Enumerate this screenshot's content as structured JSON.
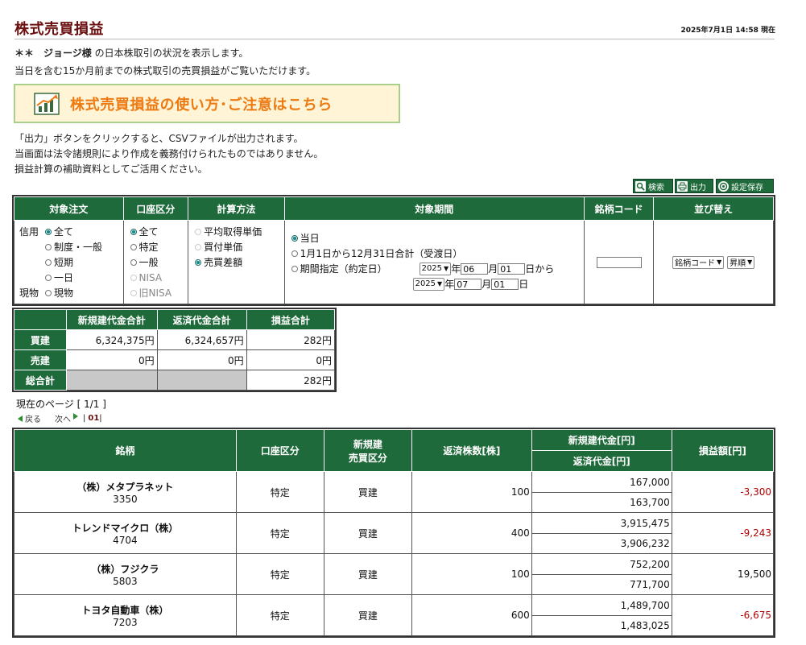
{
  "header": {
    "title": "株式売買損益",
    "timestamp": "2025年7月1日 14:58 現在"
  },
  "intro": {
    "user_prefix": "＊＊　ジョージ様",
    "user_suffix": "の日本株取引の状況を表示します。",
    "line2": "当日を含む15か月前までの株式取引の売買損益がご覧いただけます。"
  },
  "banner": {
    "text": "株式売買損益の使い方･ご注意はこちら",
    "icon": "chart-icon"
  },
  "notes": [
    "「出力」ボタンをクリックすると、CSVファイルが出力されます。",
    "当画面は法令諸規則により作成を義務付けられたものではありません。",
    "損益計算の補助資料としてご活用ください。"
  ],
  "toolbar": {
    "search": {
      "label": "検索",
      "icon": "search-icon"
    },
    "export": {
      "label": "出力",
      "icon": "printer-icon"
    },
    "save": {
      "label": "設定保存",
      "icon": "settings-icon"
    }
  },
  "filters": {
    "headers": [
      "対象注文",
      "口座区分",
      "計算方法",
      "対象期間",
      "銘柄コード",
      "並び替え"
    ],
    "order": {
      "shinyo_label": "信用",
      "genbutsu_label": "現物",
      "options": [
        "全て",
        "制度・一般",
        "短期",
        "一日",
        "現物"
      ],
      "selected": "全て"
    },
    "account": {
      "options": [
        "全て",
        "特定",
        "一般",
        "NISA",
        "旧NISA"
      ],
      "disabled": [
        "NISA",
        "旧NISA"
      ],
      "selected": "全て"
    },
    "calc": {
      "options": [
        "平均取得単価",
        "買付単価",
        "売買差額"
      ],
      "disabled": [
        "平均取得単価",
        "買付単価"
      ],
      "selected": "売買差額"
    },
    "period": {
      "options": [
        "当日",
        "1月1日から12月31日合計（受渡日）",
        "期間指定（約定日）"
      ],
      "selected": "当日",
      "from": {
        "year": "2025",
        "month": "06",
        "day": "01"
      },
      "to": {
        "year": "2025",
        "month": "07",
        "day": "01"
      },
      "unit_year": "年",
      "unit_month": "月",
      "unit_day_from": "日から",
      "unit_day_to": "日"
    },
    "code_value": "",
    "sort": {
      "field": "銘柄コード",
      "order": "昇順"
    }
  },
  "summary": {
    "headers": [
      "新規建代金合計",
      "返済代金合計",
      "損益合計"
    ],
    "rows": [
      {
        "label": "買建",
        "new": "6,324,375円",
        "repay": "6,324,657円",
        "pl": "282円"
      },
      {
        "label": "売建",
        "new": "0円",
        "repay": "0円",
        "pl": "0円"
      },
      {
        "label": "総合計",
        "new": "",
        "repay": "",
        "pl": "282円"
      }
    ]
  },
  "pager": {
    "current": "現在のページ [ 1/1 ]",
    "back": "戻る",
    "next": "次へ",
    "sep": "|",
    "page": "01"
  },
  "details": {
    "headers": {
      "name": "銘柄",
      "account": "口座区分",
      "trade_type_1": "新規建",
      "trade_type_2": "売買区分",
      "qty": "返済株数[株]",
      "new_amt": "新規建代金[円]",
      "repay_amt": "返済代金[円]",
      "pl": "損益額[円]"
    },
    "rows": [
      {
        "name": "（株）メタプラネット",
        "code": "3350",
        "account": "特定",
        "type": "買建",
        "qty": "100",
        "new": "167,000",
        "repay": "163,700",
        "pl": "-3,300"
      },
      {
        "name": "トレンドマイクロ（株）",
        "code": "4704",
        "account": "特定",
        "type": "買建",
        "qty": "400",
        "new": "3,915,475",
        "repay": "3,906,232",
        "pl": "-9,243"
      },
      {
        "name": "（株）フジクラ",
        "code": "5803",
        "account": "特定",
        "type": "買建",
        "qty": "100",
        "new": "752,200",
        "repay": "771,700",
        "pl": "19,500"
      },
      {
        "name": "トヨタ自動車（株）",
        "code": "7203",
        "account": "特定",
        "type": "買建",
        "qty": "600",
        "new": "1,489,700",
        "repay": "1,483,025",
        "pl": "-6,675"
      }
    ]
  },
  "colors": {
    "header_green": "#1e6a3a",
    "title_red": "#6b0f0f",
    "negative": "#b00000",
    "banner_orange": "#ec7a12"
  }
}
